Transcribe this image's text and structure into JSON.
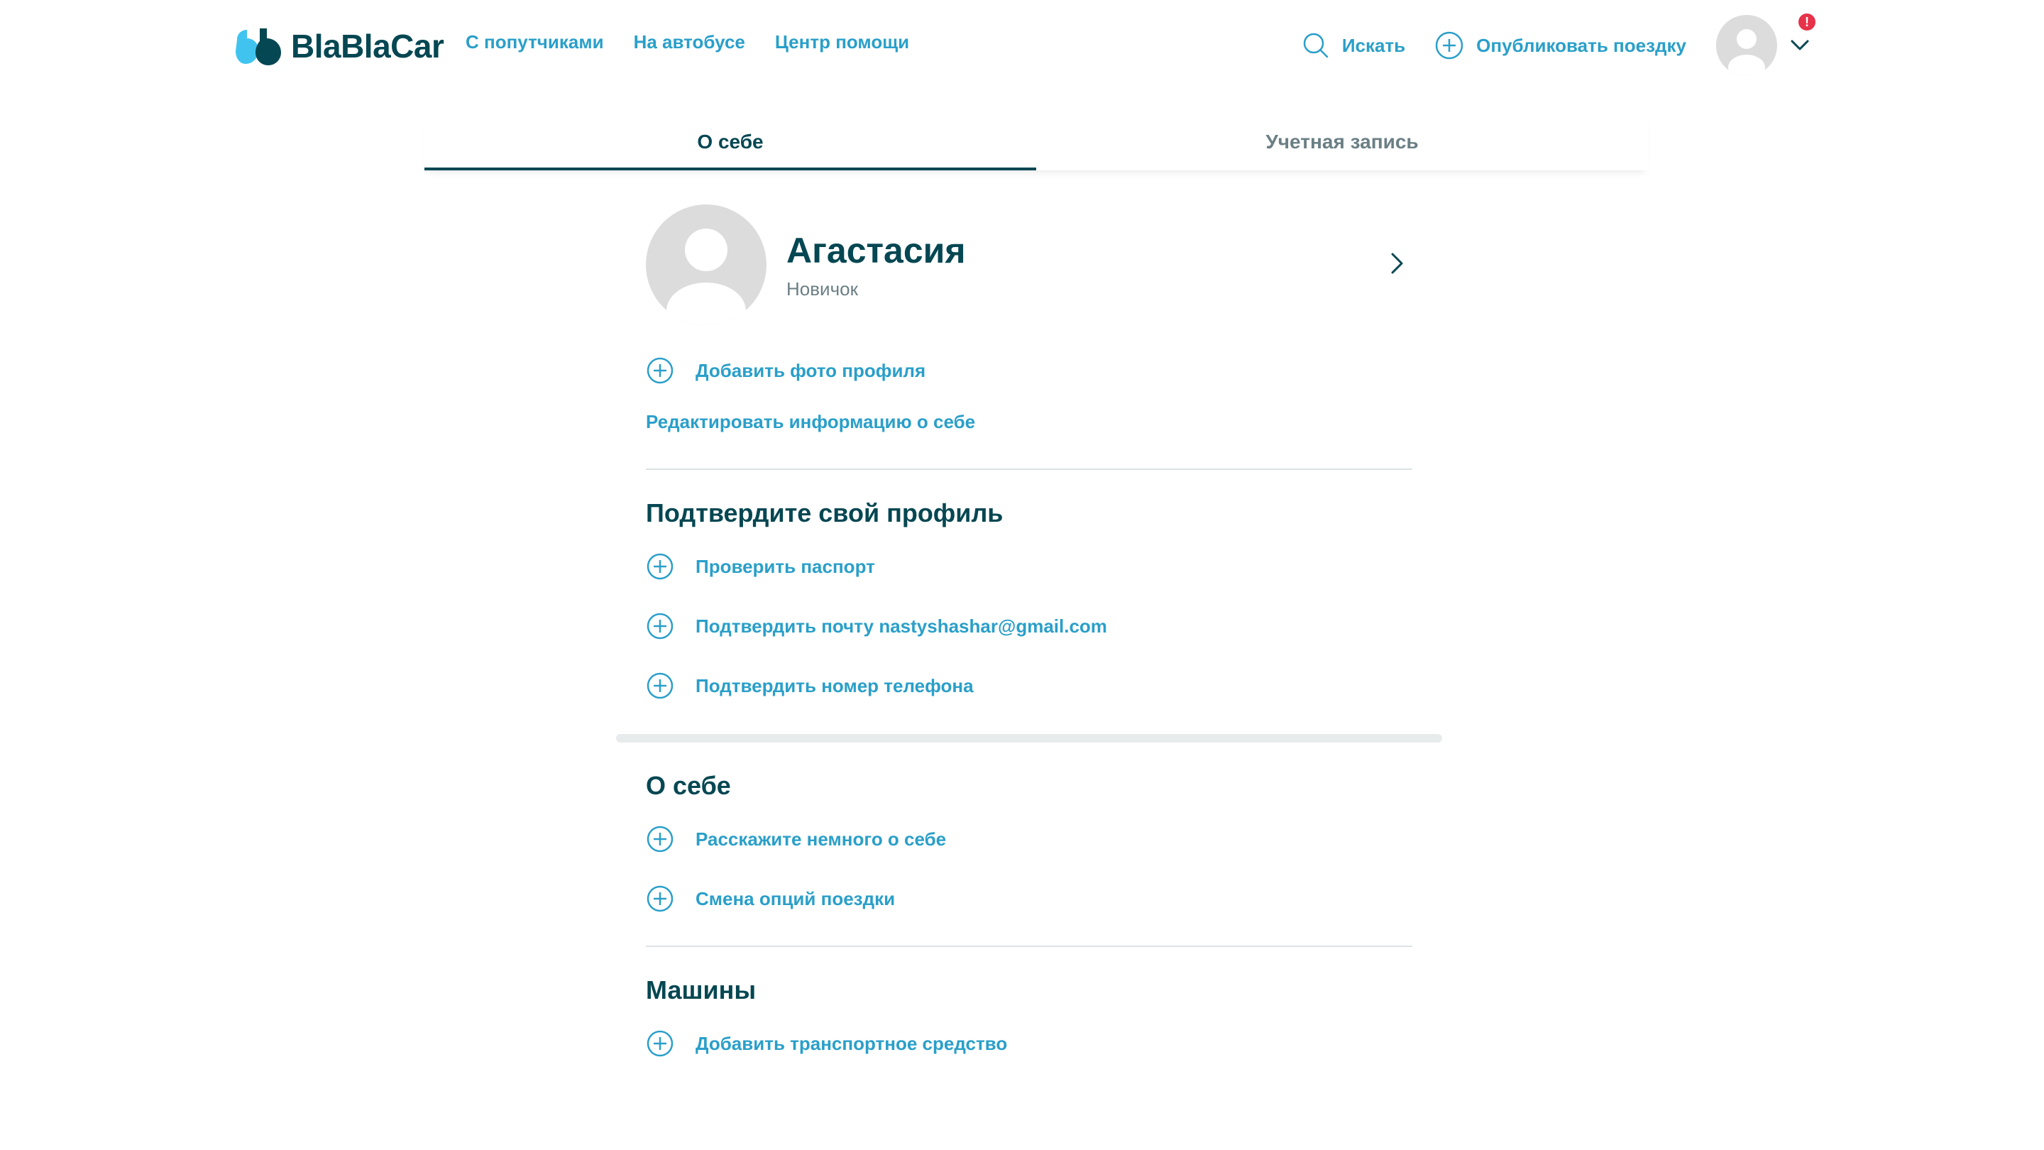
{
  "header": {
    "logo_text": "BlaBlaCar",
    "nav": [
      {
        "label": "С попутчиками"
      },
      {
        "label": "На автобусе"
      },
      {
        "label": "Центр помощи"
      }
    ],
    "search_label": "Искать",
    "publish_label": "Опубликовать поездку",
    "notification_count": "!"
  },
  "tabs": [
    {
      "label": "О себе",
      "active": true
    },
    {
      "label": "Учетная запись",
      "active": false
    }
  ],
  "profile": {
    "name": "Агастасия",
    "level": "Новичок"
  },
  "actions": {
    "add_photo": "Добавить фото профиля",
    "edit_info": "Редактировать информацию о себе"
  },
  "verify": {
    "title": "Подтвердите свой профиль",
    "items": [
      {
        "label": "Проверить паспорт"
      },
      {
        "label": "Подтвердить почту nastyshashar@gmail.com"
      },
      {
        "label": "Подтвердить номер телефона"
      }
    ]
  },
  "about": {
    "title": "О себе",
    "items": [
      {
        "label": "Расскажите немного о себе"
      },
      {
        "label": "Смена опций поездки"
      }
    ]
  },
  "cars": {
    "title": "Машины",
    "items": [
      {
        "label": "Добавить транспортное средство"
      }
    ]
  },
  "colors": {
    "accent": "#2a9fc9",
    "text_dark": "#054752",
    "badge": "#e6334a"
  }
}
